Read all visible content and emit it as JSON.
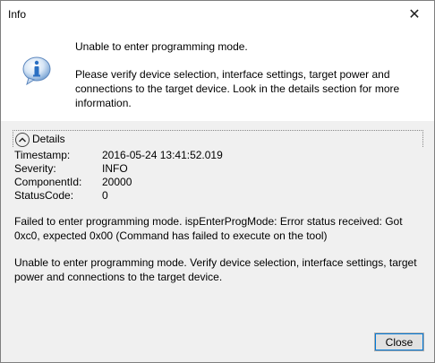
{
  "window": {
    "title": "Info"
  },
  "message": {
    "title": "Unable to enter programming mode.",
    "body": "Please verify device selection, interface settings, target power and connections to the target device. Look in the details section for more information."
  },
  "details": {
    "label": "Details",
    "fields": [
      {
        "key": "Timestamp:",
        "value": "2016-05-24 13:41:52.019"
      },
      {
        "key": "Severity:",
        "value": "INFO"
      },
      {
        "key": "ComponentId:",
        "value": "20000"
      },
      {
        "key": "StatusCode:",
        "value": "0"
      }
    ],
    "paragraph1": "Failed to enter programming mode. ispEnterProgMode: Error status received: Got 0xc0, expected 0x00 (Command has failed to execute on the tool)",
    "paragraph2": "Unable to enter programming mode. Verify device selection, interface settings, target power and connections to the target device."
  },
  "buttons": {
    "close_label": "Close"
  },
  "icons": {
    "info": "info-icon",
    "close": "close-icon",
    "collapse": "chevron-up-icon"
  },
  "colors": {
    "icon_blue": "#2a6fc2",
    "focus": "#0078d7"
  }
}
